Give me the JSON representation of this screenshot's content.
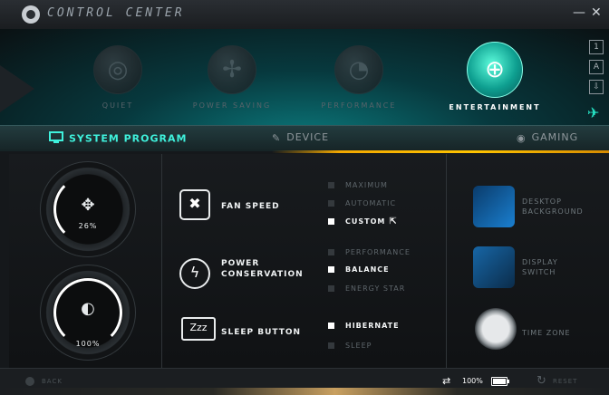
{
  "app": {
    "title": "CONTROL CENTER",
    "minimize": "—",
    "close": "✕"
  },
  "modes": [
    {
      "label": "QUIET",
      "icon": "speaker-icon",
      "active": false
    },
    {
      "label": "POWER SAVING",
      "icon": "windmill-icon",
      "active": false
    },
    {
      "label": "PERFORMANCE",
      "icon": "speedometer-icon",
      "active": false
    },
    {
      "label": "ENTERTAINMENT",
      "icon": "target-icon",
      "active": true
    }
  ],
  "side_buttons": [
    "1",
    "A",
    "⇩"
  ],
  "tabs": [
    {
      "label": "SYSTEM PROGRAM",
      "icon": "monitor-icon",
      "active": true
    },
    {
      "label": "DEVICE",
      "icon": "devices-icon",
      "active": false
    },
    {
      "label": "GAMING",
      "icon": "eye-icon",
      "active": false
    }
  ],
  "dials": [
    {
      "value": "26%",
      "icon": "fan-center-icon",
      "level": 0.26
    },
    {
      "value": "100%",
      "icon": "brightness-center-icon",
      "level": 1.0
    }
  ],
  "features": {
    "fan_speed": {
      "label": "FAN SPEED",
      "options": [
        {
          "label": "MAXIMUM",
          "selected": false
        },
        {
          "label": "AUTOMATIC",
          "selected": false
        },
        {
          "label": "CUSTOM",
          "selected": true
        }
      ],
      "custom_ext": "⇱"
    },
    "power": {
      "label_line1": "POWER",
      "label_line2": "CONSERVATION",
      "options": [
        {
          "label": "PERFORMANCE",
          "selected": false
        },
        {
          "label": "BALANCE",
          "selected": true
        },
        {
          "label": "ENERGY STAR",
          "selected": false
        }
      ]
    },
    "sleep": {
      "label": "SLEEP BUTTON",
      "icon_text": "Zzz",
      "options": [
        {
          "label": "HIBERNATE",
          "selected": true
        },
        {
          "label": "SLEEP",
          "selected": false
        }
      ]
    }
  },
  "right_panel": [
    {
      "line1": "DESKTOP",
      "line2": "BACKGROUND",
      "icon": "windows-icon"
    },
    {
      "line1": "DISPLAY",
      "line2": "SWITCH",
      "icon": "display-switch-icon"
    },
    {
      "line1": "TIME ZONE",
      "line2": "",
      "icon": "clock-icon"
    }
  ],
  "bottom": {
    "back_label": "BACK",
    "battery_value": "100%",
    "battery_level": 1.0,
    "reset_label": "RESET"
  },
  "colors": {
    "accent": "#3ff1dc",
    "highlight": "#ffc400"
  }
}
